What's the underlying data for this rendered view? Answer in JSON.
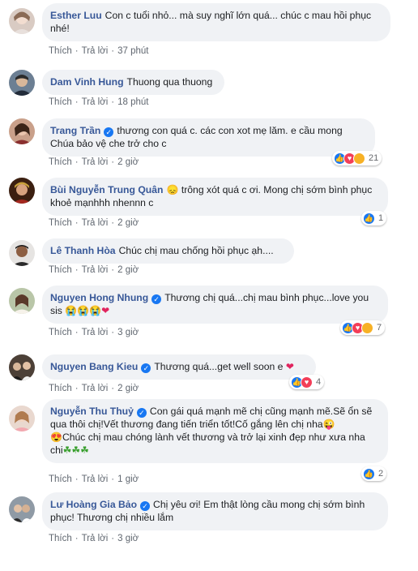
{
  "labels": {
    "like": "Thích",
    "reply": "Trả lời",
    "dot": "·"
  },
  "colors": {
    "bubble": "#f0f2f5",
    "name": "#385898",
    "meta": "#606770",
    "like": "#1877f2",
    "love": "#f33e58",
    "sad": "#f7b125"
  },
  "comments": [
    {
      "author": "Esther Luu",
      "text": "Con c tuổi nhỏ... mà suy nghĩ lớn quá... chúc c mau hồi phục nhé!",
      "time": "37 phút"
    },
    {
      "author": "Dam Vinh Hung",
      "text": "Thuong qua thuong",
      "time": "18 phút"
    },
    {
      "author": "Trang Trần",
      "text": "thương con quá c. các con xot mẹ lăm. e cầu mong Chúa bảo vệ che trở cho c",
      "time": "2 giờ",
      "reaction_count": "21"
    },
    {
      "author": "Bùi Nguyễn Trung Quân",
      "text": "trông xót quá c ơi. Mong chị sớm bình phục khoẻ mạnhhh nhennn c",
      "time": "2 giờ",
      "reaction_count": "1"
    },
    {
      "author": "Lê Thanh Hòa",
      "text": "Chúc chị mau chống hồi phục ạh....",
      "time": "2 giờ"
    },
    {
      "author": "Nguyen Hong Nhung",
      "text": "Thương chị quá...chị mau bình phục...love you sis",
      "time": "3 giờ",
      "reaction_count": "7"
    },
    {
      "author": "Nguyen Bang Kieu",
      "text": "Thương quá...get well soon e",
      "time": "2 giờ",
      "reaction_count": "4"
    },
    {
      "author": "Nguyễn Thu Thuỷ",
      "text": "Con gái quá mạnh mẽ chị cũng mạnh mẽ.Sẽ ổn sẽ qua thôi chị!Vết thương đang tiến triển tốt!Cố gắng lên chị nha",
      "text2": "Chúc chị mau chóng lành vết thương và trở lại xinh đẹp như xưa nha chi",
      "time": "1 giờ",
      "reaction_count": "2"
    },
    {
      "author": "Lư Hoàng Gia Bảo",
      "text": "Chị yêu ơi! Em thật lòng cầu mong chị sớm bình phục! Thương chị nhiều lắm",
      "time": "3 giờ"
    }
  ]
}
